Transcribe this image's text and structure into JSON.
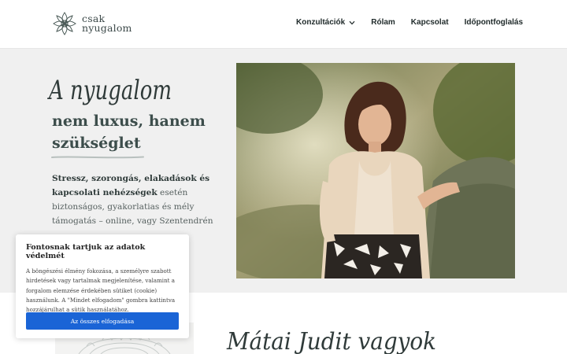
{
  "logo": {
    "line1": "csak",
    "line2": "nyugalom"
  },
  "nav": {
    "items": [
      {
        "label": "Konzultációk",
        "has_dropdown": true
      },
      {
        "label": "Rólam"
      },
      {
        "label": "Kapcsolat"
      },
      {
        "label": "Időpontfoglalás"
      }
    ]
  },
  "hero": {
    "script_title": "A nyugalom",
    "heading_line1": "nem luxus, hanem",
    "heading_line2": "szükséglet",
    "lead_bold": "Stressz, szorongás, elakadások és kapcsolati nehézségek",
    "lead_rest": " esetén biztonságos, gyakorlatias és mély támogatás – online, vagy Szentendrén"
  },
  "about": {
    "script_name": "Mátai Judit vagyok"
  },
  "cookie": {
    "title": "Fontosnak tartjuk az adatok védelmét",
    "text": "A böngészési élmény fokozása, a személyre szabott hirdetések vagy tartalmak megjelenítése, valamint a forgalom elemzése érdekében sütiket (cookie) használunk. A \"Mindet elfogadom\" gombra kattintva hozzájárulhat a sütik használatához.",
    "accept_label": "Az összes elfogadása"
  },
  "colors": {
    "text_dark": "#3c4d4b",
    "hero_bg": "#f0f0f0",
    "button": "#1a64d6"
  }
}
